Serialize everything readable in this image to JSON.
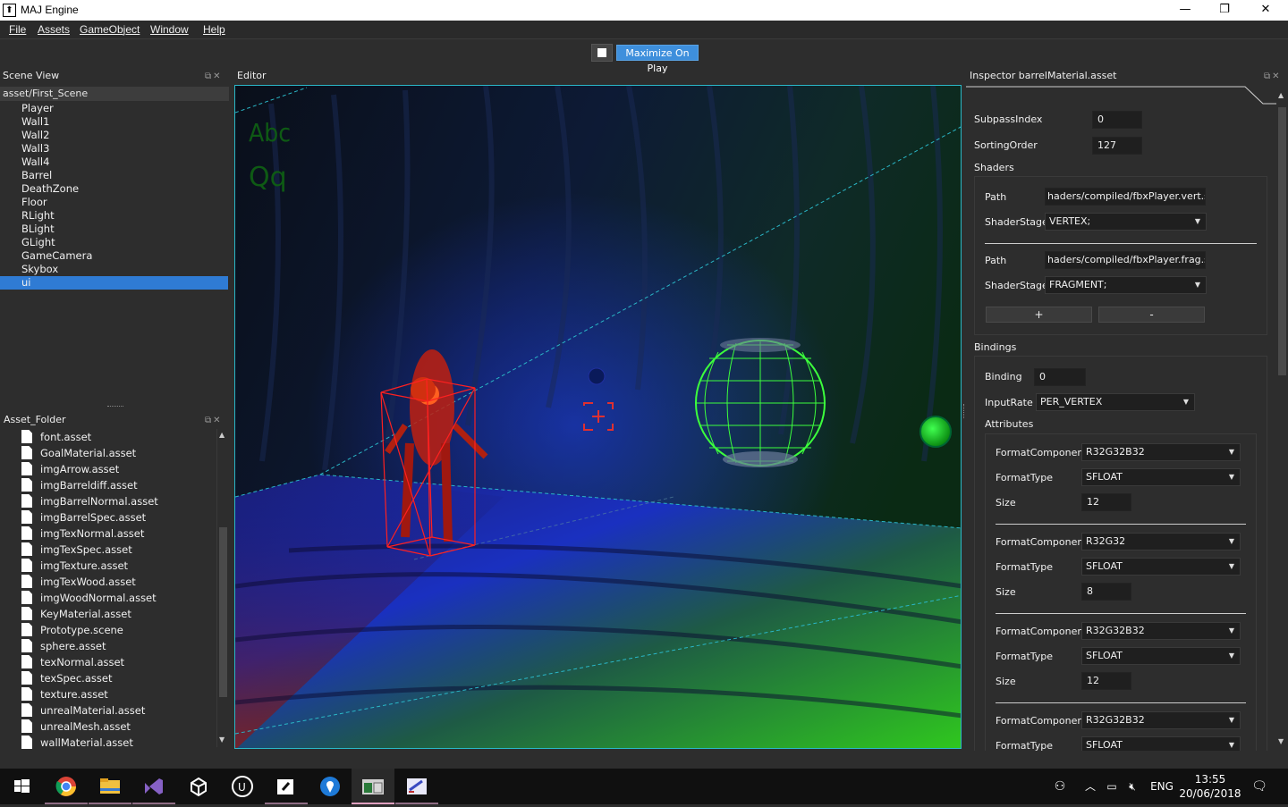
{
  "window": {
    "title": "MAJ Engine",
    "minimize": "—",
    "restore": "❐",
    "close": "✕"
  },
  "menu": [
    "File",
    "Assets",
    "GameObject",
    "Window",
    "Help"
  ],
  "toolbar": {
    "maximize_label": "Maximize On Play"
  },
  "scene_view": {
    "title": "Scene View",
    "path": "asset/First_Scene",
    "items": [
      "Player",
      "Wall1",
      "Wall2",
      "Wall3",
      "Wall4",
      "Barrel",
      "DeathZone",
      "Floor",
      "RLight",
      "BLight",
      "GLight",
      "GameCamera",
      "Skybox",
      "ui"
    ],
    "selected": "ui"
  },
  "asset_folder": {
    "title": "Asset_Folder",
    "items": [
      "font.asset",
      "GoalMaterial.asset",
      "imgArrow.asset",
      "imgBarreldiff.asset",
      "imgBarrelNormal.asset",
      "imgBarrelSpec.asset",
      "imgTexNormal.asset",
      "imgTexSpec.asset",
      "imgTexture.asset",
      "imgTexWood.asset",
      "imgWoodNormal.asset",
      "KeyMaterial.asset",
      "Prototype.scene",
      "sphere.asset",
      "texNormal.asset",
      "texSpec.asset",
      "texture.asset",
      "unrealMaterial.asset",
      "unrealMesh.asset",
      "wallMaterial.asset"
    ]
  },
  "editor": {
    "title": "Editor",
    "overlay_text_1": "Abc",
    "overlay_text_2": "Qq"
  },
  "inspector": {
    "title": "Inspector barrelMaterial.asset",
    "subpass_label": "SubpassIndex",
    "subpass_value": "0",
    "sorting_label": "SortingOrder",
    "sorting_value": "127",
    "shaders_label": "Shaders",
    "shaders": [
      {
        "path_label": "Path",
        "path": "haders/compiled/fbxPlayer.vert.spv",
        "stage_label": "ShaderStage",
        "stage": "VERTEX;"
      },
      {
        "path_label": "Path",
        "path": "haders/compiled/fbxPlayer.frag.spv",
        "stage_label": "ShaderStage",
        "stage": "FRAGMENT;"
      }
    ],
    "add_label": "+",
    "remove_label": "-",
    "bindings_label": "Bindings",
    "binding_label": "Binding",
    "binding_value": "0",
    "input_rate_label": "InputRate",
    "input_rate": "PER_VERTEX",
    "attributes_label": "Attributes",
    "attributes": [
      {
        "fc_label": "FormatComponent",
        "fc": "R32G32B32",
        "ft_label": "FormatType",
        "ft": "SFLOAT",
        "size_label": "Size",
        "size": "12"
      },
      {
        "fc_label": "FormatComponent",
        "fc": "R32G32",
        "ft_label": "FormatType",
        "ft": "SFLOAT",
        "size_label": "Size",
        "size": "8"
      },
      {
        "fc_label": "FormatComponent",
        "fc": "R32G32B32",
        "ft_label": "FormatType",
        "ft": "SFLOAT",
        "size_label": "Size",
        "size": "12"
      },
      {
        "fc_label": "FormatComponent",
        "fc": "R32G32B32",
        "ft_label": "FormatType",
        "ft": "SFLOAT"
      }
    ]
  },
  "taskbar": {
    "apps": [
      "windows-start-icon",
      "chrome-icon",
      "file-explorer-icon",
      "visual-studio-icon",
      "unity-icon",
      "unreal-icon",
      "sublime-icon",
      "maps-icon",
      "maj-engine-icon",
      "paint-icon"
    ],
    "language": "ENG",
    "time": "13:55",
    "date": "20/06/2018"
  },
  "colors": {
    "accent": "#2f7bd4",
    "editor_border": "#2ab7c7",
    "bbox_red": "#e02020",
    "barrel_green": "#3cff3c"
  }
}
